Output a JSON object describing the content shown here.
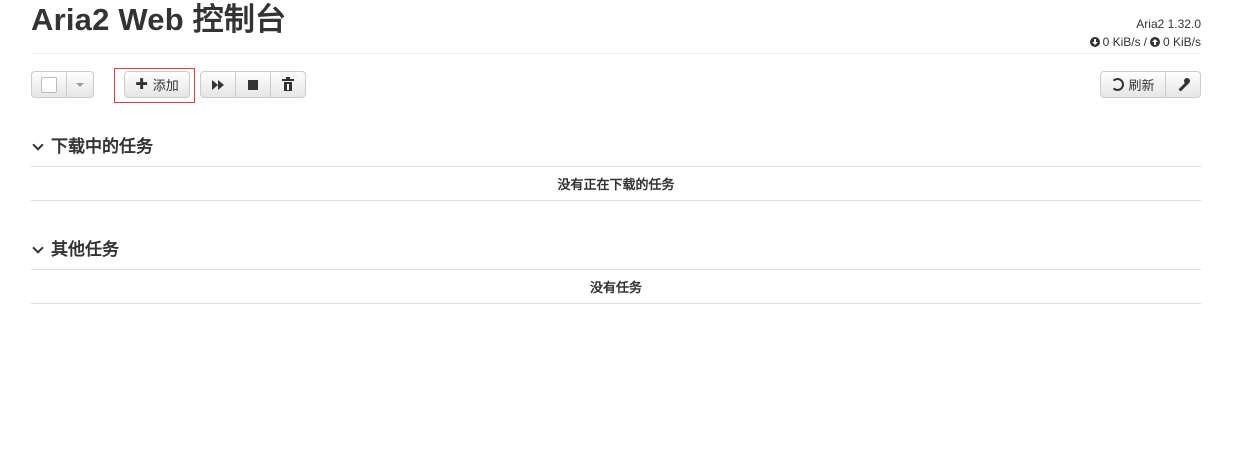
{
  "header": {
    "title": "Aria2 Web 控制台",
    "version": "Aria2 1.32.0",
    "download_speed": "0 KiB/s",
    "separator": "/",
    "upload_speed": "0 KiB/s"
  },
  "toolbar": {
    "add_label": "添加",
    "refresh_label": "刷新",
    "icons": [
      "checkbox-icon",
      "caret-down-icon",
      "plus-icon",
      "fast-forward-icon",
      "stop-icon",
      "trash-icon",
      "refresh-icon",
      "wrench-icon"
    ]
  },
  "sections": {
    "downloading": {
      "title": "下载中的任务",
      "empty_text": "没有正在下载的任务"
    },
    "others": {
      "title": "其他任务",
      "empty_text": "没有任务"
    }
  },
  "colors": {
    "highlight_border": "#e03c3c",
    "text": "#333333",
    "divider": "#dddddd"
  }
}
